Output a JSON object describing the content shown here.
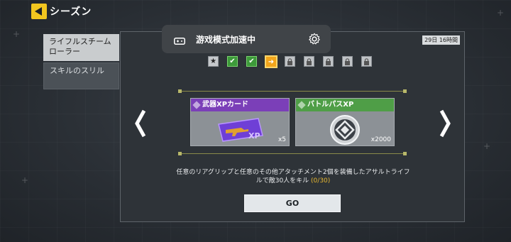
{
  "header": {
    "title": "シーズン",
    "back_icon": "back-arrow-icon"
  },
  "tabs": [
    {
      "label": "ライフルスチームローラー",
      "active": true
    },
    {
      "label": "スキルのスリル",
      "active": false
    }
  ],
  "timer": "29日 16時間",
  "accel_overlay": {
    "text": "游戏模式加速中",
    "icons": [
      "gamepad-icon",
      "gear-icon"
    ]
  },
  "stages": [
    {
      "state": "star",
      "icon": "star-icon",
      "glyph": "★"
    },
    {
      "state": "done",
      "icon": "check-icon",
      "glyph": "✔"
    },
    {
      "state": "done",
      "icon": "check-icon",
      "glyph": "✔"
    },
    {
      "state": "current",
      "icon": "arrow-right-icon",
      "glyph": "➜"
    },
    {
      "state": "locked",
      "icon": "lock-icon",
      "glyph": "🔒"
    },
    {
      "state": "locked",
      "icon": "lock-icon",
      "glyph": "🔒"
    },
    {
      "state": "locked",
      "icon": "lock-icon",
      "glyph": "🔒"
    },
    {
      "state": "locked",
      "icon": "lock-icon",
      "glyph": "🔒"
    },
    {
      "state": "locked",
      "icon": "lock-icon",
      "glyph": "🔒"
    }
  ],
  "rewards": [
    {
      "title": "武器XPカード",
      "quantity": "x5",
      "header_color": "#7b3fb8",
      "image_label": "XP"
    },
    {
      "title": "バトルパスXP",
      "quantity": "x2000",
      "header_color": "#4f9e47"
    }
  ],
  "mission": {
    "text": "任意のリアグリップと任意のその他アタッチメント2個を装備したアサルトライフルで敵30人をキル",
    "progress": "(0/30)"
  },
  "go_button": "GO",
  "colors": {
    "accent": "#f2c61f",
    "panel": "#2e3338",
    "done": "#3d9a3a",
    "current": "#f2a51b"
  }
}
